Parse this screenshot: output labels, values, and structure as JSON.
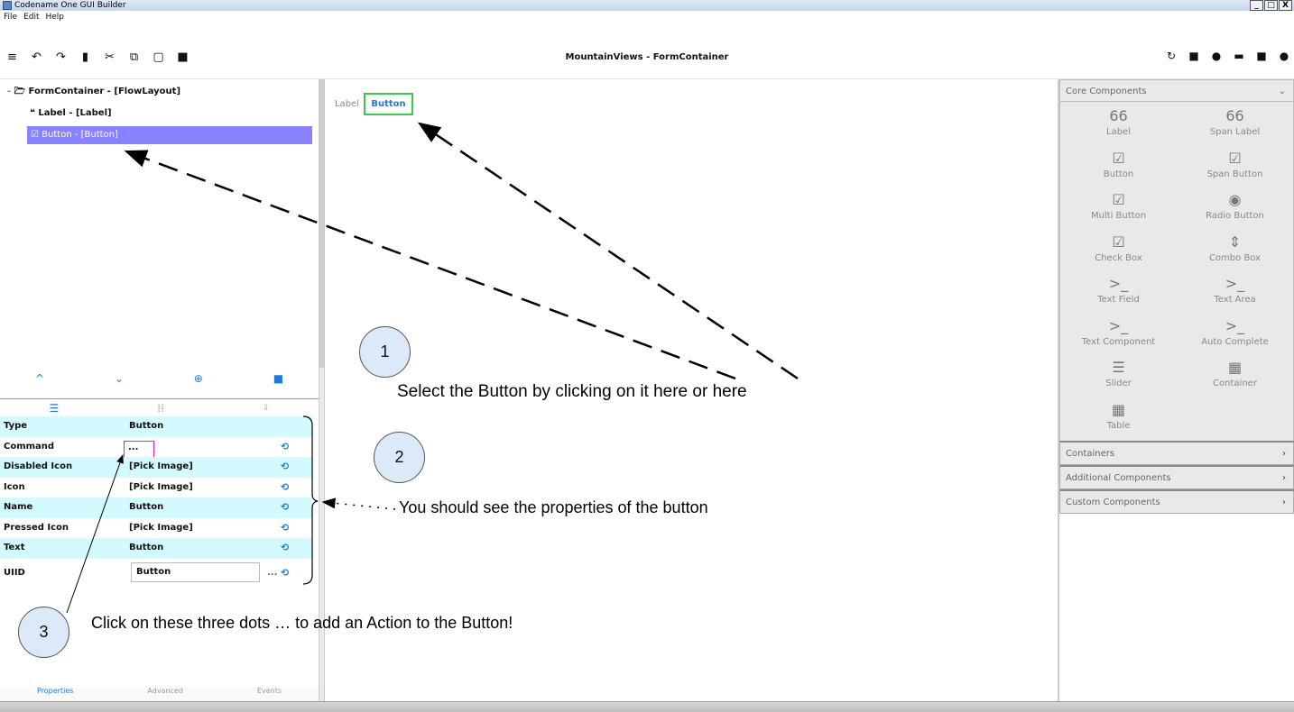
{
  "window": {
    "title": "Codename One GUI Builder",
    "controls": [
      "_",
      "□",
      "X"
    ]
  },
  "menu": [
    "File",
    "Edit",
    "Help"
  ],
  "toolbar": {
    "title": "MountainViews - FormContainer",
    "left_icons": [
      "menu-icon",
      "undo-icon",
      "redo-icon",
      "delete-icon",
      "cut-icon",
      "copy-icon",
      "paste-icon",
      "save-icon"
    ],
    "right_icons": [
      "refresh-icon",
      "image-icon",
      "record-icon",
      "preview-icon",
      "save-icon",
      "play-icon"
    ]
  },
  "tree": {
    "root": "FormContainer - [FlowLayout]",
    "children": [
      "Label - [Label]",
      "Button - [Button]"
    ]
  },
  "properties": {
    "rows": [
      {
        "name": "Type",
        "value": "Button"
      },
      {
        "name": "Command",
        "value": "..."
      },
      {
        "name": "Disabled Icon",
        "value": "[Pick Image]"
      },
      {
        "name": "Icon",
        "value": "[Pick Image]"
      },
      {
        "name": "Name",
        "value": "Button"
      },
      {
        "name": "Pressed Icon",
        "value": "[Pick Image]"
      },
      {
        "name": "Text",
        "value": "Button"
      },
      {
        "name": "UIID",
        "value": "Button",
        "more": "..."
      }
    ]
  },
  "bottom_tabs": [
    "Properties",
    "Advanced",
    "Events"
  ],
  "canvas": {
    "label_text": "Label",
    "button_text": "Button"
  },
  "palette": {
    "core_title": "Core Components",
    "items": [
      {
        "label": "Label",
        "icon": "66"
      },
      {
        "label": "Span Label",
        "icon": "66"
      },
      {
        "label": "Button",
        "icon": "☑"
      },
      {
        "label": "Span Button",
        "icon": "☑"
      },
      {
        "label": "Multi Button",
        "icon": "☑"
      },
      {
        "label": "Radio Button",
        "icon": "◉"
      },
      {
        "label": "Check Box",
        "icon": "☑"
      },
      {
        "label": "Combo Box",
        "icon": "⇕"
      },
      {
        "label": "Text Field",
        "icon": ">_"
      },
      {
        "label": "Text Area",
        "icon": ">_"
      },
      {
        "label": "Text Component",
        "icon": ">_"
      },
      {
        "label": "Auto Complete",
        "icon": ">_"
      },
      {
        "label": "Slider",
        "icon": "☰"
      },
      {
        "label": "Container",
        "icon": "▦"
      },
      {
        "label": "Table",
        "icon": "▦"
      }
    ],
    "sections": [
      "Containers",
      "Additional Components",
      "Custom Components"
    ]
  },
  "annotations": {
    "step1_number": "1",
    "step1_text": "Select the Button by clicking on it here or here",
    "step2_number": "2",
    "step2_text": "You should see the properties of the button",
    "step3_number": "3",
    "step3_text": "Click on these three dots … to add an Action to the Button!"
  }
}
